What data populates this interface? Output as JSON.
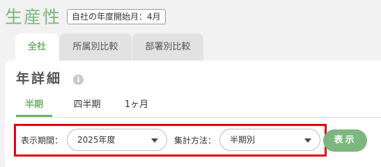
{
  "header": {
    "title": "生産性",
    "fiscal_year_badge": "自社の年度開始月：4月"
  },
  "top_tabs": [
    {
      "label": "全社",
      "active": true
    },
    {
      "label": "所属別比較",
      "active": false
    },
    {
      "label": "部署別比較",
      "active": false
    }
  ],
  "section": {
    "title": "年詳細",
    "info_icon": "i"
  },
  "period_tabs": [
    {
      "label": "半期",
      "active": true
    },
    {
      "label": "四半期",
      "active": false
    },
    {
      "label": "1ヶ月",
      "active": false
    }
  ],
  "filters": {
    "period_label": "表示期間：",
    "period_value": "2025年度",
    "method_label": "集計方法：",
    "method_value": "半期別"
  },
  "actions": {
    "show_label": "表示"
  },
  "colors": {
    "accent": "#7ab87f",
    "highlight_border": "#e60012"
  }
}
